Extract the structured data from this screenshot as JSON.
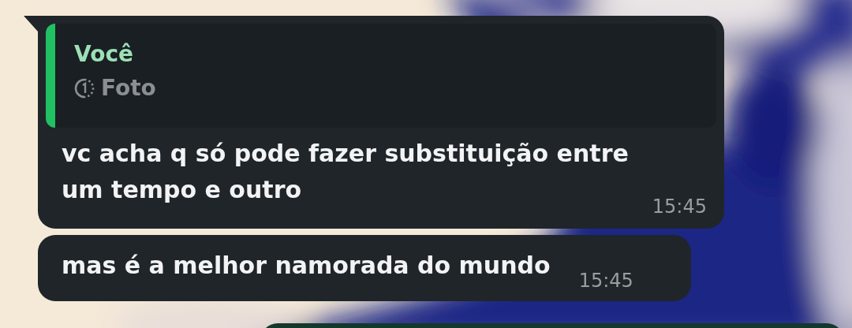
{
  "messages": [
    {
      "kind": "reply",
      "tail": true,
      "quote": {
        "author": "Você",
        "media_label": "Foto"
      },
      "text": "vc acha q só pode fazer substituição entre um tempo e outro",
      "time": "15:45"
    },
    {
      "kind": "plain",
      "tail": false,
      "text": "mas é a melhor namorada do mundo",
      "time": "15:45"
    },
    {
      "kind": "partial",
      "tail": false
    }
  ]
}
